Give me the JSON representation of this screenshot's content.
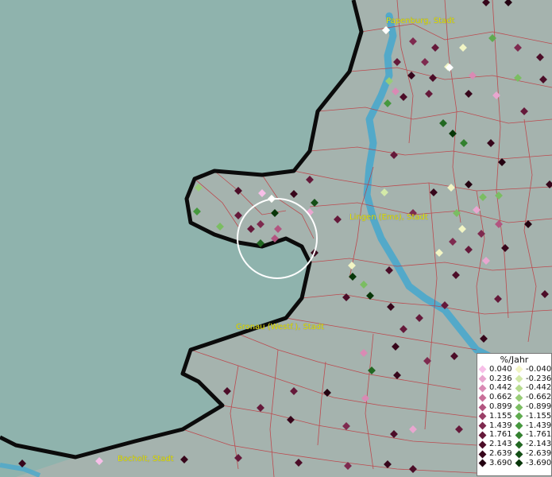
{
  "cities": [
    {
      "name": "Papenburg, Stadt"
    },
    {
      "name": "Lingen (Ems), Stadt"
    },
    {
      "name": "Gronau (Westf.), Stadt"
    },
    {
      "name": "Bocholt, Stadt"
    }
  ],
  "legend": {
    "title": "%/Jahr",
    "positive": [
      "0.040",
      "0.236",
      "0.442",
      "0.662",
      "0.899",
      "1.155",
      "1.439",
      "1.761",
      "2.143",
      "2.639",
      "3.690"
    ],
    "negative": [
      "-0.040",
      "-0.236",
      "-0.442",
      "-0.662",
      "-0.899",
      "-1.155",
      "-1.439",
      "-1.761",
      "-2.143",
      "-2.639",
      "-3.690"
    ],
    "positive_colors": [
      "#f7bfe8",
      "#e8a6cf",
      "#d98ab4",
      "#c86f98",
      "#b25580",
      "#9a3f67",
      "#7e2a4f",
      "#65193a",
      "#4c0d28",
      "#37061b",
      "#240211"
    ],
    "negative_colors": [
      "#f2f5c4",
      "#d3e9a8",
      "#b6db8e",
      "#98cc77",
      "#7bbd62",
      "#5fab4f",
      "#46983e",
      "#33812f",
      "#226822",
      "#134f15",
      "#083609"
    ]
  },
  "selection_marker": "circle"
}
